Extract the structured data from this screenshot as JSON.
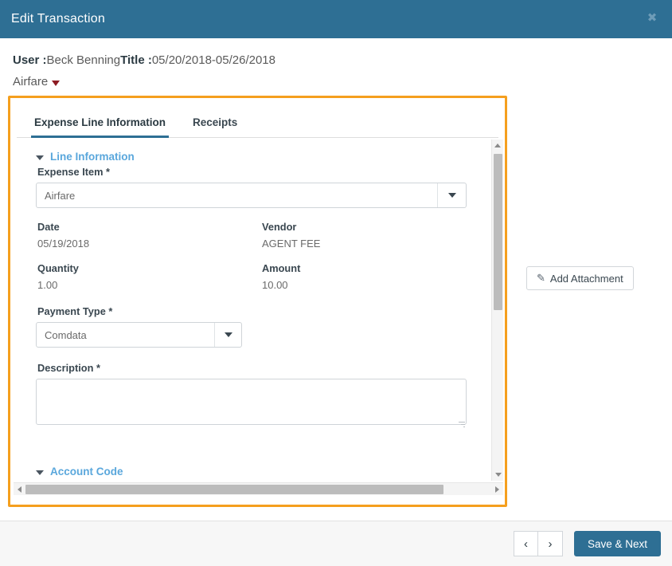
{
  "titlebar": {
    "title": "Edit Transaction",
    "close_label": "✖"
  },
  "meta": {
    "user_key": "User :",
    "user_value": "Beck Benning",
    "title_key": "Title :",
    "title_value": "05/20/2018-05/26/2018",
    "category": "Airfare"
  },
  "tabs": [
    {
      "label": "Expense Line Information",
      "active": true
    },
    {
      "label": "Receipts",
      "active": false
    }
  ],
  "sections": {
    "line_information": "Line Information",
    "account_code": "Account Code"
  },
  "fields": {
    "expense_item": {
      "label": "Expense Item *",
      "value": "Airfare"
    },
    "date": {
      "label": "Date",
      "value": "05/19/2018"
    },
    "vendor": {
      "label": "Vendor",
      "value": "AGENT FEE"
    },
    "quantity": {
      "label": "Quantity",
      "value": "1.00"
    },
    "amount": {
      "label": "Amount",
      "value": "10.00"
    },
    "payment_type": {
      "label": "Payment Type *",
      "value": "Comdata"
    },
    "description": {
      "label": "Description *",
      "value": "",
      "placeholder": ""
    }
  },
  "attachment": {
    "label": "Add Attachment",
    "icon": "paperclip-icon",
    "glyph": "✎"
  },
  "footer": {
    "prev_label": "‹",
    "next_label": "›",
    "save_label": "Save & Next"
  },
  "colors": {
    "header_blue": "#2e6f94",
    "highlight_orange": "#f59f1e",
    "section_link_blue": "#5aa7dc",
    "caret_red": "#8d1b23"
  }
}
